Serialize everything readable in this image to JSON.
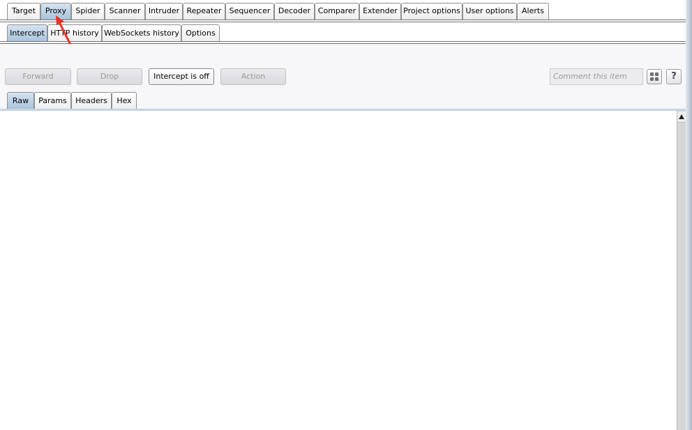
{
  "main_tabs": [
    {
      "label": "Target",
      "active": false
    },
    {
      "label": "Proxy",
      "active": true
    },
    {
      "label": "Spider",
      "active": false
    },
    {
      "label": "Scanner",
      "active": false
    },
    {
      "label": "Intruder",
      "active": false
    },
    {
      "label": "Repeater",
      "active": false
    },
    {
      "label": "Sequencer",
      "active": false
    },
    {
      "label": "Decoder",
      "active": false
    },
    {
      "label": "Comparer",
      "active": false
    },
    {
      "label": "Extender",
      "active": false
    },
    {
      "label": "Project options",
      "active": false
    },
    {
      "label": "User options",
      "active": false
    },
    {
      "label": "Alerts",
      "active": false
    }
  ],
  "proxy_tabs": [
    {
      "label": "Intercept",
      "active": true
    },
    {
      "label": "HTTP history",
      "active": false
    },
    {
      "label": "WebSockets history",
      "active": false
    },
    {
      "label": "Options",
      "active": false
    }
  ],
  "intercept": {
    "forward_label": "Forward",
    "drop_label": "Drop",
    "toggle_label": "Intercept is off",
    "action_label": "Action",
    "comment_placeholder": "Comment this item",
    "help_glyph": "?"
  },
  "view_tabs": [
    {
      "label": "Raw",
      "active": true
    },
    {
      "label": "Params",
      "active": false
    },
    {
      "label": "Headers",
      "active": false
    },
    {
      "label": "Hex",
      "active": false
    }
  ],
  "colors": {
    "active_tab_top": "#d4e3f2",
    "active_tab_bottom": "#a9c3dc",
    "annotation_arrow": "#e8302a"
  }
}
